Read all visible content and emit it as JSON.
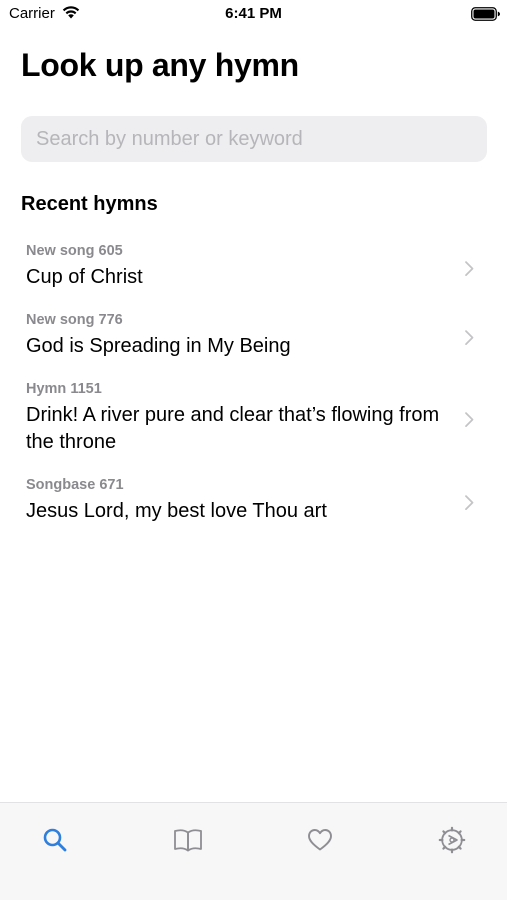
{
  "status_bar": {
    "carrier": "Carrier",
    "time": "6:41 PM"
  },
  "header": {
    "title": "Look up any hymn"
  },
  "search": {
    "placeholder": "Search by number or keyword",
    "value": ""
  },
  "recent": {
    "title": "Recent hymns",
    "items": [
      {
        "meta": "New song 605",
        "title": "Cup of Christ"
      },
      {
        "meta": "New song 776",
        "title": "God is Spreading in My Being"
      },
      {
        "meta": "Hymn 1151",
        "title": "Drink! A river pure and clear that’s flowing from the throne"
      },
      {
        "meta": "Songbase 671",
        "title": "Jesus Lord, my best love Thou art"
      }
    ]
  },
  "tab_bar": {
    "tabs": [
      {
        "icon": "search-icon",
        "active": true
      },
      {
        "icon": "book-icon",
        "active": false
      },
      {
        "icon": "heart-icon",
        "active": false
      },
      {
        "icon": "settings-icon",
        "active": false
      }
    ]
  },
  "colors": {
    "accent": "#2f7fdc",
    "inactive_icon": "#8e8e93",
    "secondary_text": "#8a8a8e",
    "search_bg": "#eeeef0",
    "tab_bar_bg": "#f7f7f7"
  }
}
